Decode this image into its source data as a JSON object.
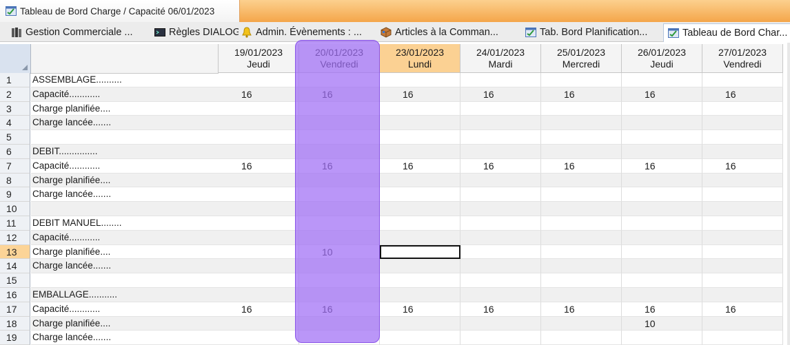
{
  "window": {
    "title": "Tableau de Bord Charge / Capacité 06/01/2023",
    "accent": "#f4a64a"
  },
  "tabs": [
    {
      "label": "Gestion Commerciale ...",
      "icon": "books-icon"
    },
    {
      "label": "Règles DIALOG",
      "icon": "terminal-icon"
    },
    {
      "label": "Admin. Évènements : ...",
      "icon": "bell-icon"
    },
    {
      "label": "Articles à la Comman...",
      "icon": "cube-icon"
    },
    {
      "label": "Tab. Bord Planification...",
      "icon": "dashboard-icon"
    },
    {
      "label": "Tableau de Bord Char...",
      "icon": "dashboard-icon",
      "active": true
    }
  ],
  "grid": {
    "days": [
      {
        "date": "19/01/2023",
        "day": "Jeudi"
      },
      {
        "date": "20/01/2023",
        "day": "Vendredi"
      },
      {
        "date": "23/01/2023",
        "day": "Lundi",
        "today": true
      },
      {
        "date": "24/01/2023",
        "day": "Mardi"
      },
      {
        "date": "25/01/2023",
        "day": "Mercredi"
      },
      {
        "date": "26/01/2023",
        "day": "Jeudi"
      },
      {
        "date": "27/01/2023",
        "day": "Vendredi"
      }
    ],
    "rows": [
      {
        "n": "1",
        "label": "ASSEMBLAGE..........",
        "values": [
          "",
          "",
          "",
          "",
          "",
          "",
          ""
        ]
      },
      {
        "n": "2",
        "label": "Capacité............",
        "values": [
          "16",
          "16",
          "16",
          "16",
          "16",
          "16",
          "16"
        ]
      },
      {
        "n": "3",
        "label": "Charge planifiée....",
        "values": [
          "",
          "",
          "",
          "",
          "",
          "",
          ""
        ]
      },
      {
        "n": "4",
        "label": "Charge lancée.......",
        "values": [
          "",
          "",
          "",
          "",
          "",
          "",
          ""
        ]
      },
      {
        "n": "5",
        "label": "",
        "values": [
          "",
          "",
          "",
          "",
          "",
          "",
          ""
        ]
      },
      {
        "n": "6",
        "label": "DEBIT...............",
        "values": [
          "",
          "",
          "",
          "",
          "",
          "",
          ""
        ]
      },
      {
        "n": "7",
        "label": "Capacité............",
        "values": [
          "16",
          "16",
          "16",
          "16",
          "16",
          "16",
          "16"
        ]
      },
      {
        "n": "8",
        "label": "Charge planifiée....",
        "values": [
          "",
          "",
          "",
          "",
          "",
          "",
          ""
        ]
      },
      {
        "n": "9",
        "label": "Charge lancée.......",
        "values": [
          "",
          "",
          "",
          "",
          "",
          "",
          ""
        ]
      },
      {
        "n": "10",
        "label": "",
        "values": [
          "",
          "",
          "",
          "",
          "",
          "",
          ""
        ]
      },
      {
        "n": "11",
        "label": "DEBIT MANUEL........",
        "values": [
          "",
          "",
          "",
          "",
          "",
          "",
          ""
        ]
      },
      {
        "n": "12",
        "label": "Capacité............",
        "values": [
          "",
          "",
          "",
          "",
          "",
          "",
          ""
        ]
      },
      {
        "n": "13",
        "label": "Charge planifiée....",
        "values": [
          "",
          "10",
          "",
          "",
          "",
          "",
          ""
        ],
        "selected_row": true,
        "selected_col": 2
      },
      {
        "n": "14",
        "label": "Charge lancée.......",
        "values": [
          "",
          "",
          "",
          "",
          "",
          "",
          ""
        ]
      },
      {
        "n": "15",
        "label": "",
        "values": [
          "",
          "",
          "",
          "",
          "",
          "",
          ""
        ]
      },
      {
        "n": "16",
        "label": "EMBALLAGE...........",
        "values": [
          "",
          "",
          "",
          "",
          "",
          "",
          ""
        ]
      },
      {
        "n": "17",
        "label": "Capacité............",
        "values": [
          "16",
          "16",
          "16",
          "16",
          "16",
          "16",
          "16"
        ]
      },
      {
        "n": "18",
        "label": "Charge planifiée....",
        "values": [
          "",
          "",
          "",
          "",
          "",
          "10",
          ""
        ]
      },
      {
        "n": "19",
        "label": "Charge lancée.......",
        "values": [
          "",
          "",
          "",
          "",
          "",
          "",
          ""
        ]
      }
    ]
  },
  "highlight_color": "#a06ef5"
}
